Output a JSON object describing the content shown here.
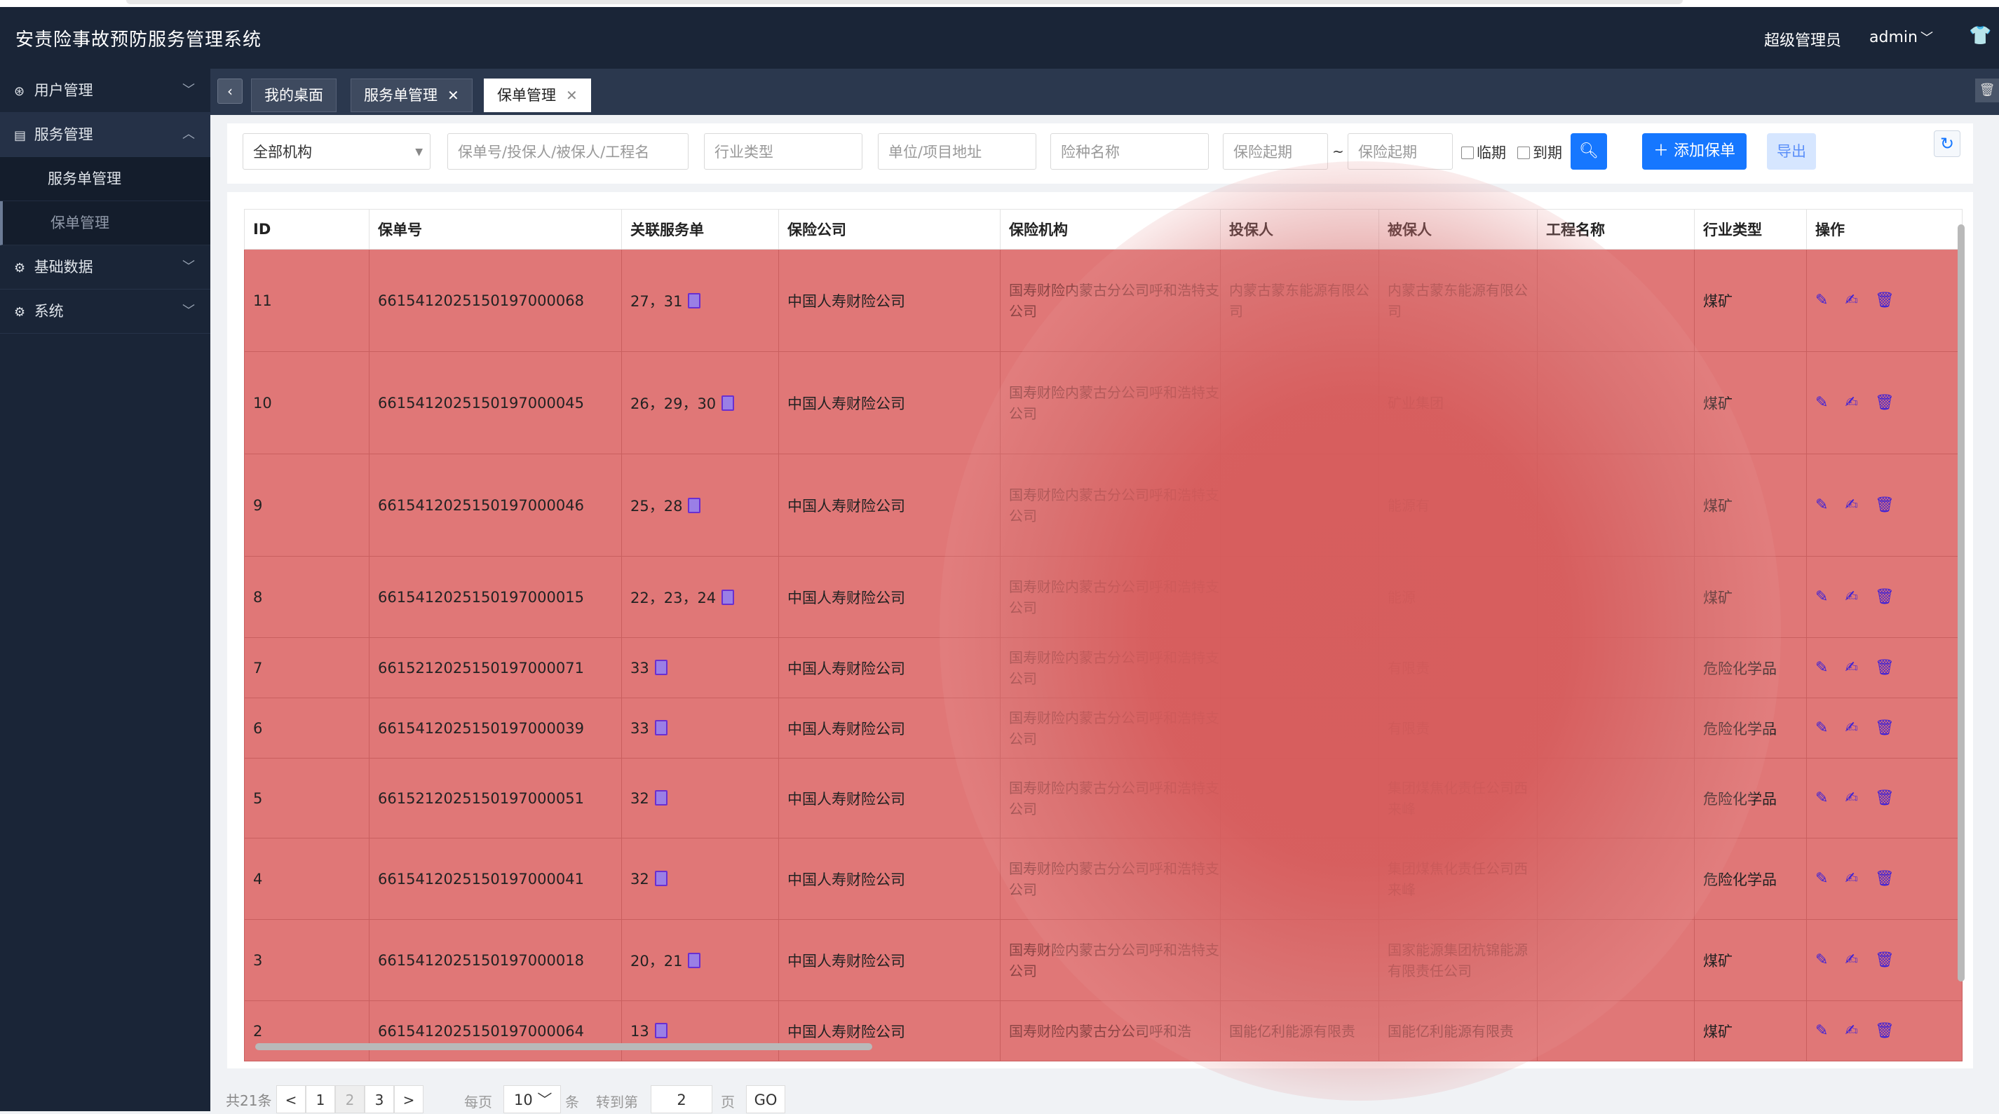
{
  "app": {
    "title": "安责险事故预防服务管理系统",
    "role": "超级管理员",
    "user": "admin"
  },
  "sidebar": {
    "items": [
      {
        "label": "用户管理"
      },
      {
        "label": "服务管理",
        "children": [
          "服务单管理",
          "保单管理"
        ]
      },
      {
        "label": "基础数据"
      },
      {
        "label": "系统"
      }
    ]
  },
  "tabs": [
    "我的桌面",
    "服务单管理",
    "保单管理"
  ],
  "filters": {
    "org": "全部机构",
    "keyword_placeholder": "保单号/投保人/被保人/工程名",
    "industry_placeholder": "行业类型",
    "address_placeholder": "单位/项目地址",
    "insurance_placeholder": "险种名称",
    "date_from_placeholder": "保险起期",
    "tilde": "~",
    "date_to_placeholder": "保险起期",
    "near_expiry": "临期",
    "expired": "到期",
    "add_button": "添加保单",
    "export_button": "导出"
  },
  "table": {
    "columns": [
      "ID",
      "保单号",
      "关联服务单",
      "保险公司",
      "保险机构",
      "投保人",
      "被保人",
      "工程名称",
      "行业类型",
      "操作"
    ],
    "rows": [
      {
        "id": "11",
        "policy": "6615412025150197000068",
        "svc": "27，31",
        "company": "中国人寿财险公司",
        "org": "国寿财险内蒙古分公司呼和浩特支公司",
        "holder": "内蒙古蒙东能源有限公司",
        "insured": "内蒙古蒙东能源有限公司",
        "project": "",
        "industry": "煤矿"
      },
      {
        "id": "10",
        "policy": "6615412025150197000045",
        "svc": "26，29，30",
        "company": "中国人寿财险公司",
        "org": "国寿财险内蒙古分公司呼和浩特支公司",
        "holder": "",
        "insured": "矿业集团",
        "project": "",
        "industry": "煤矿"
      },
      {
        "id": "9",
        "policy": "6615412025150197000046",
        "svc": "25，28",
        "company": "中国人寿财险公司",
        "org": "国寿财险内蒙古分公司呼和浩特支公司",
        "holder": "",
        "insured": "能源有",
        "project": "",
        "industry": "煤矿"
      },
      {
        "id": "8",
        "policy": "6615412025150197000015",
        "svc": "22，23，24",
        "company": "中国人寿财险公司",
        "org": "国寿财险内蒙古分公司呼和浩特支公司",
        "holder": "",
        "insured": "能源",
        "project": "",
        "industry": "煤矿"
      },
      {
        "id": "7",
        "policy": "6615212025150197000071",
        "svc": "33",
        "company": "中国人寿财险公司",
        "org": "国寿财险内蒙古分公司呼和浩特支公司",
        "holder": "",
        "insured": "有限责",
        "project": "",
        "industry": "危险化学品"
      },
      {
        "id": "6",
        "policy": "6615412025150197000039",
        "svc": "33",
        "company": "中国人寿财险公司",
        "org": "国寿财险内蒙古分公司呼和浩特支公司",
        "holder": "",
        "insured": "有限责",
        "project": "",
        "industry": "危险化学品"
      },
      {
        "id": "5",
        "policy": "6615212025150197000051",
        "svc": "32",
        "company": "中国人寿财险公司",
        "org": "国寿财险内蒙古分公司呼和浩特支公司",
        "holder": "",
        "insured": "集团煤焦化责任公司西来峰",
        "project": "",
        "industry": "危险化学品"
      },
      {
        "id": "4",
        "policy": "6615412025150197000041",
        "svc": "32",
        "company": "中国人寿财险公司",
        "org": "国寿财险内蒙古分公司呼和浩特支公司",
        "holder": "",
        "insured": "集团煤焦化责任公司西来峰",
        "project": "",
        "industry": "危险化学品"
      },
      {
        "id": "3",
        "policy": "6615412025150197000018",
        "svc": "20，21",
        "company": "中国人寿财险公司",
        "org": "国寿财险内蒙古分公司呼和浩特支公司",
        "holder": "",
        "insured": "国家能源集团杭锦能源有限责任公司",
        "project": "",
        "industry": "煤矿"
      },
      {
        "id": "2",
        "policy": "6615412025150197000064",
        "svc": "13",
        "company": "中国人寿财险公司",
        "org": "国寿财险内蒙古分公司呼和浩",
        "holder": "国能亿利能源有限责",
        "insured": "国能亿利能源有限责",
        "project": "",
        "industry": "煤矿"
      }
    ]
  },
  "pagination": {
    "total": "共21条",
    "prev": "<",
    "p1": "1",
    "p2": "2",
    "p3": "3",
    "next": ">",
    "per_page_label": "每页",
    "per_page": "10",
    "unit": "条",
    "goto_label": "转到第",
    "goto_value": "2",
    "page_unit": "页",
    "go": "GO"
  }
}
